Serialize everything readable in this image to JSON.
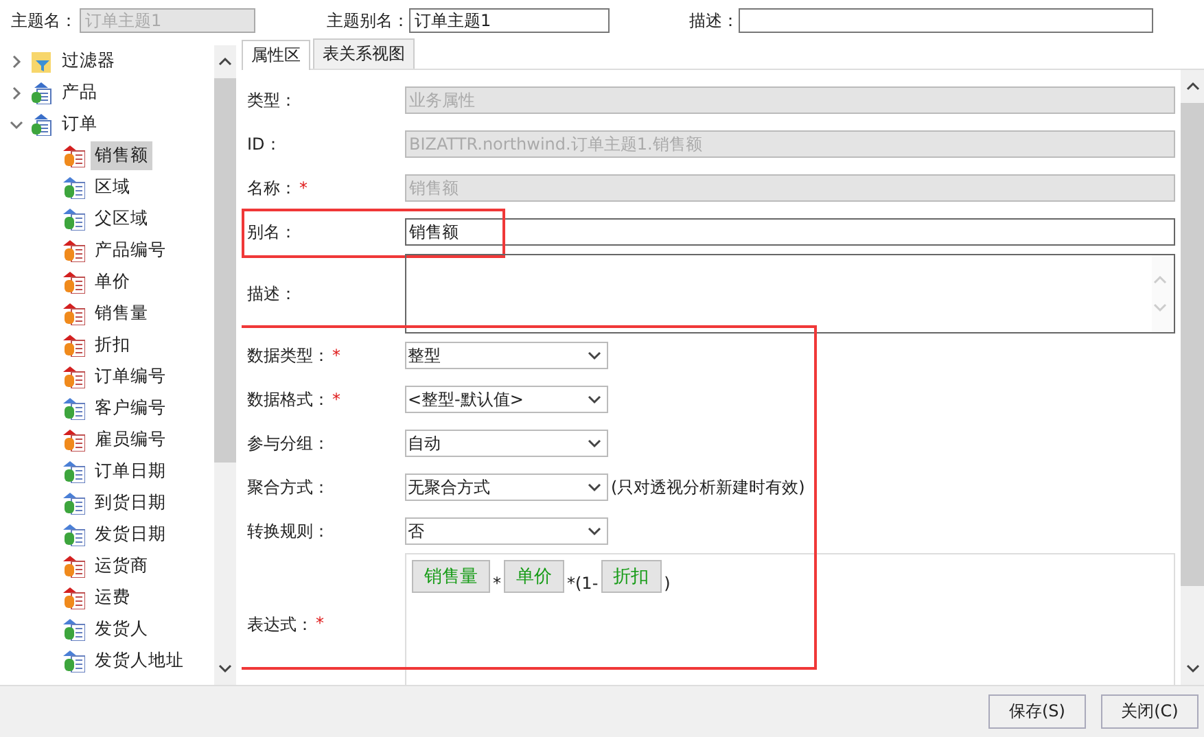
{
  "header": {
    "fields": [
      {
        "label": "主题名：",
        "value": "订单主题1",
        "disabled": true
      },
      {
        "label": "主题别名：",
        "value": "订单主题1",
        "disabled": false
      },
      {
        "label": "描述：",
        "disabled": false
      }
    ]
  },
  "tree": {
    "items": [
      {
        "label": "过滤器",
        "kind": "filter",
        "expanded": false,
        "selected": false
      },
      {
        "label": "产品",
        "kind": "table",
        "expanded": false,
        "selected": false
      },
      {
        "label": "订单",
        "kind": "table",
        "expanded": true,
        "selected": false,
        "children": [
          {
            "label": "销售额",
            "kind": "measure",
            "selected": true
          },
          {
            "label": "区域",
            "kind": "dimension",
            "selected": false
          },
          {
            "label": "父区域",
            "kind": "dimension",
            "selected": false
          },
          {
            "label": "产品编号",
            "kind": "measure",
            "selected": false
          },
          {
            "label": "单价",
            "kind": "measure",
            "selected": false
          },
          {
            "label": "销售量",
            "kind": "measure",
            "selected": false
          },
          {
            "label": "折扣",
            "kind": "measure",
            "selected": false
          },
          {
            "label": "订单编号",
            "kind": "measure",
            "selected": false
          },
          {
            "label": "客户编号",
            "kind": "dimension",
            "selected": false
          },
          {
            "label": "雇员编号",
            "kind": "measure",
            "selected": false
          },
          {
            "label": "订单日期",
            "kind": "dimension",
            "selected": false
          },
          {
            "label": "到货日期",
            "kind": "dimension",
            "selected": false
          },
          {
            "label": "发货日期",
            "kind": "dimension",
            "selected": false
          },
          {
            "label": "运货商",
            "kind": "measure",
            "selected": false
          },
          {
            "label": "运费",
            "kind": "measure",
            "selected": false
          },
          {
            "label": "发货人",
            "kind": "dimension",
            "selected": false
          },
          {
            "label": "发货人地址",
            "kind": "dimension",
            "selected": false
          }
        ]
      }
    ]
  },
  "tabs": [
    {
      "label": "属性区",
      "selected": true
    },
    {
      "label": "表关系视图",
      "selected": false
    }
  ],
  "form": {
    "sections": [
      {
        "highlighted": false,
        "rows": [
          {
            "kind": "text",
            "label": "类型：",
            "required": false,
            "value": "业务属性",
            "disabled": true
          },
          {
            "kind": "text",
            "label": "ID：",
            "required": false,
            "value": "BIZATTR.northwind.订单主题1.销售额",
            "disabled": true
          },
          {
            "kind": "text",
            "label": "名称：",
            "required": true,
            "value": "销售额",
            "disabled": true
          }
        ]
      },
      {
        "highlighted": true,
        "rows": [
          {
            "kind": "text",
            "label": "别名：",
            "required": false,
            "value": "销售额",
            "disabled": false
          }
        ]
      },
      {
        "highlighted": false,
        "rows": [
          {
            "kind": "textarea",
            "label": "描述：",
            "required": false
          }
        ]
      },
      {
        "highlighted": true,
        "rows": [
          {
            "kind": "select",
            "label": "数据类型：",
            "required": true,
            "value": "整型"
          },
          {
            "kind": "select",
            "label": "数据格式：",
            "required": true,
            "value": "<整型-默认值>"
          },
          {
            "kind": "select",
            "label": "参与分组：",
            "required": false,
            "value": "自动"
          },
          {
            "kind": "select",
            "label": "聚合方式：",
            "required": false,
            "value": "无聚合方式",
            "note": "(只对透视分析新建时有效)"
          },
          {
            "kind": "select",
            "label": "转换规则：",
            "required": false,
            "value": "否"
          },
          {
            "kind": "expression",
            "label": "表达式：",
            "required": true,
            "parts": [
              {
                "kind": "token",
                "text": "销售量"
              },
              {
                "kind": "op",
                "text": "*"
              },
              {
                "kind": "token",
                "text": "单价"
              },
              {
                "kind": "op",
                "text": "*(1-"
              },
              {
                "kind": "token",
                "text": "折扣"
              },
              {
                "kind": "op",
                "text": ")"
              }
            ]
          }
        ]
      }
    ]
  },
  "buttons": [
    {
      "label": "保存(S)"
    },
    {
      "label": "关闭(C)"
    }
  ]
}
